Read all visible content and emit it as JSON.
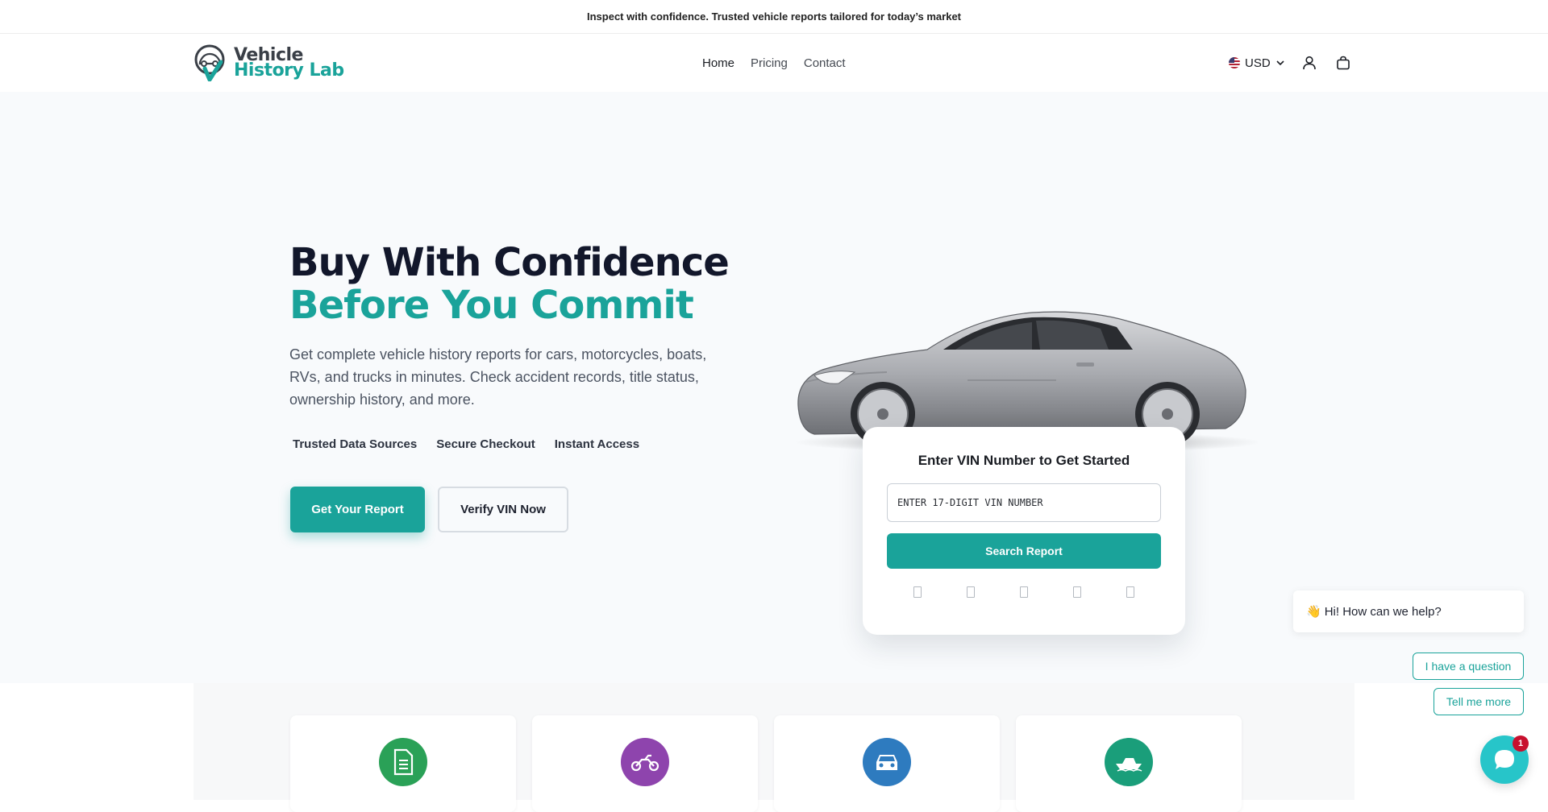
{
  "announcement": "Inspect with confidence. Trusted vehicle reports tailored for today’s market",
  "brand": {
    "line1": "Vehicle",
    "line2": "History Lab",
    "primary_color": "#1aa39a",
    "dark_color": "#3a3f47"
  },
  "nav": {
    "items": [
      {
        "label": "Home"
      },
      {
        "label": "Pricing"
      },
      {
        "label": "Contact"
      }
    ]
  },
  "header": {
    "currency": "USD",
    "account_icon": "user-icon",
    "cart_icon": "bag-icon"
  },
  "hero": {
    "title_line1": "Buy With Confidence",
    "title_line2": "Before You Commit",
    "subtitle": "Get complete vehicle history reports for cars, motorcycles, boats, RVs, and trucks in minutes. Check accident records, title status, ownership history, and more.",
    "badges": [
      {
        "glyph": "",
        "label": "Trusted Data Sources"
      },
      {
        "glyph": "",
        "label": "Secure Checkout"
      },
      {
        "glyph": "",
        "label": "Instant Access"
      }
    ],
    "primary_cta": "Get Your Report",
    "secondary_cta": "Verify VIN Now"
  },
  "vin_card": {
    "title": "Enter VIN Number to Get Started",
    "placeholder": "ENTER 17-DIGIT VIN NUMBER",
    "button": "Search Report",
    "vehicle_icon_count": 5
  },
  "features": [
    {
      "icon": "document-icon",
      "color": "#2aa157"
    },
    {
      "icon": "motorcycle-icon",
      "color": "#8e44ad"
    },
    {
      "icon": "car-icon",
      "color": "#2e7bbf"
    },
    {
      "icon": "boat-icon",
      "color": "#1a9e7a"
    }
  ],
  "chat": {
    "greeting_emoji": "👋",
    "greeting": "Hi! How can we help?",
    "option1": "I have a question",
    "option2": "Tell me more",
    "unread": "1"
  }
}
